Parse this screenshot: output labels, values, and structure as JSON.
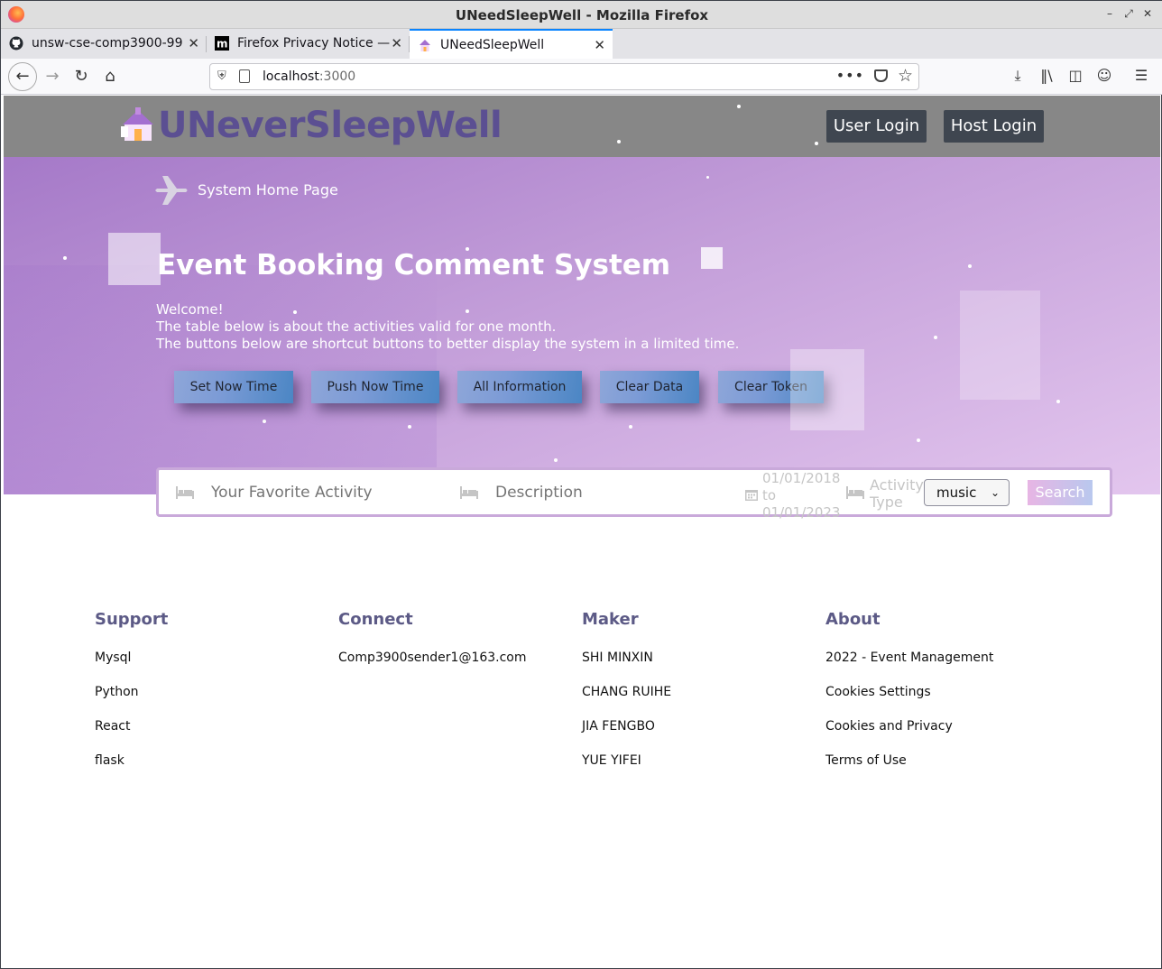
{
  "browser": {
    "window_title": "UNeedSleepWell - Mozilla Firefox",
    "tabs": [
      {
        "label": "unsw-cse-comp3900-99",
        "active": false
      },
      {
        "label": "Firefox Privacy Notice —",
        "active": false
      },
      {
        "label": "UNeedSleepWell",
        "active": true
      }
    ],
    "url_host": "localhost",
    "url_port": ":3000",
    "url_dots": "•••"
  },
  "header": {
    "brand": "UNeverSleepWell",
    "user_login": "User Login",
    "host_login": "Host Login"
  },
  "hero": {
    "breadcrumb": "System Home Page",
    "title": "Event Booking Comment System",
    "welcome": "Welcome!",
    "line1": "The table below is about the activities valid for one month.",
    "line2": "The buttons below are shortcut buttons to better display the system in a limited time.",
    "buttons": [
      "Set Now Time",
      "Push Now Time",
      "All Information",
      "Clear Data",
      "Clear Token"
    ]
  },
  "search": {
    "activity_placeholder": "Your Favorite Activity",
    "description_placeholder": "Description",
    "date_from": "01/01/2018",
    "date_sep": "to",
    "date_to": "01/01/2023",
    "activity_type_label_1": "Activity",
    "activity_type_label_2": "Type",
    "activity_type_value": "music",
    "search_label": "Search"
  },
  "footer": {
    "support": {
      "title": "Support",
      "items": [
        "Mysql",
        "Python",
        "React",
        "flask"
      ]
    },
    "connect": {
      "title": "Connect",
      "items": [
        "Comp3900sender1@163.com"
      ]
    },
    "maker": {
      "title": "Maker",
      "items": [
        "SHI MINXIN",
        "CHANG RUIHE",
        "JIA FENGBO",
        "YUE YIFEI"
      ]
    },
    "about": {
      "title": "About",
      "items": [
        "2022 - Event Management",
        "Cookies Settings",
        "Cookies and Privacy",
        "Terms of Use"
      ]
    }
  },
  "colors": {
    "brand": "#5b4f92",
    "header_bg": "#878787",
    "hero_start": "#a579c8",
    "hero_end": "#e3c6ee",
    "footer_heading": "#5c5a86"
  }
}
